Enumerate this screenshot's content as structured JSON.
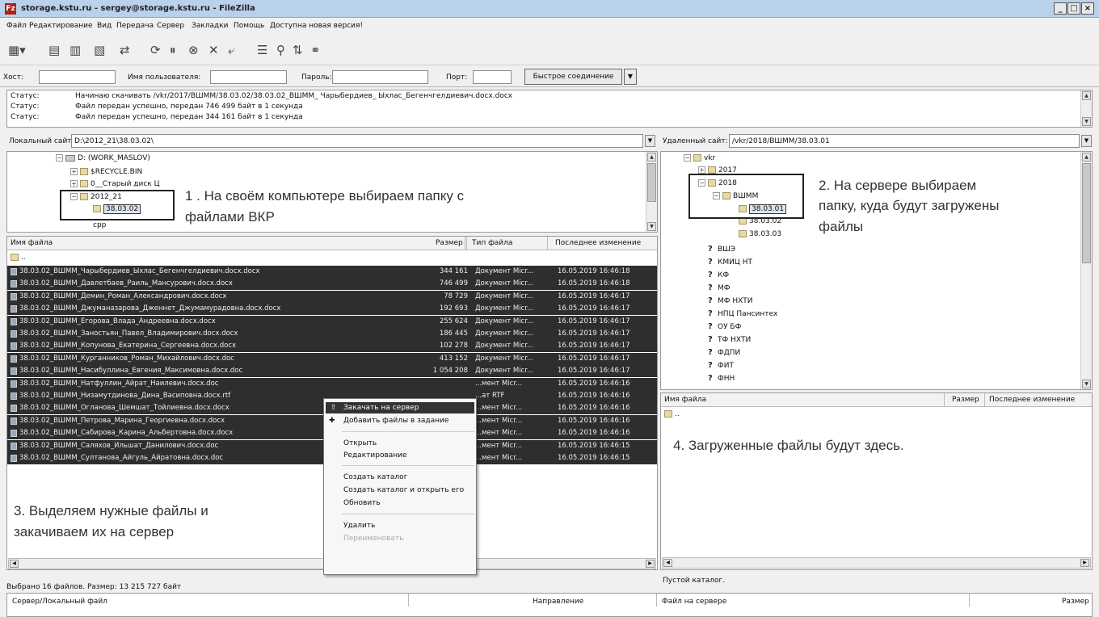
{
  "window": {
    "title": "storage.kstu.ru - sergey@storage.kstu.ru - FileZilla",
    "app_icon_text": "Fz",
    "controls": {
      "minimize": "_",
      "maximize": "□",
      "close": "×"
    }
  },
  "menu": [
    "Файл",
    "Редактирование",
    "Вид",
    "Передача",
    "Сервер",
    "Закладки",
    "Помощь",
    "Доступна новая версия!"
  ],
  "toolbar": {
    "icons": [
      "site-manager-icon",
      "toggle-log-icon",
      "toggle-local-tree-icon",
      "toggle-remote-tree-icon",
      "toggle-queue-icon",
      "refresh-icon",
      "process-queue-icon",
      "cancel-icon",
      "disconnect-icon",
      "reconnect-icon",
      "filter-icon",
      "compare-icon",
      "sync-browse-icon",
      "search-icon"
    ]
  },
  "quickconnect": {
    "host_label": "Хост:",
    "host_value": "",
    "user_label": "Имя пользователя:",
    "user_value": "",
    "pass_label": "Пароль:",
    "pass_value": "",
    "port_label": "Порт:",
    "port_value": "",
    "connect_button": "Быстрое соединение",
    "dropdown_arrow": "▼"
  },
  "log": [
    {
      "key": "Статус:",
      "text": "Начинаю скачивать /vkr/2017/ВШММ/38.03.02/38.03.02_ВШММ_ Чарыбердиев_ Ыхлас_Бегенчгелдиевич.docx.docx"
    },
    {
      "key": "Статус:",
      "text": "Файл передан успешно, передан 746 499 байт в 1 секунда"
    },
    {
      "key": "Статус:",
      "text": "Файл передан успешно, передан 344 161 байт в 1 секунда"
    }
  ],
  "local": {
    "path_label": "Локальный сайт:",
    "path_value": "D:\\2012_21\\38.03.02\\",
    "tree": {
      "drive": "D: (WORK_MASLOV)",
      "recycle": "$RECYCLE.BIN",
      "old_disk": "0__Старый диск Ц",
      "folder": "2012_21",
      "subfolder": "38.03.02",
      "cutoff": "cpp"
    },
    "columns": {
      "name": "Имя файла",
      "size": "Размер",
      "type": "Тип файла",
      "modified": "Последнее изменение"
    },
    "parent": "..",
    "files": [
      {
        "name": "38.03.02_ВШММ_Чарыбердиев_Ыхлас_Бегенчгелдиевич.docx.docx",
        "size": "344 161",
        "type": "Документ Micr...",
        "date": "16.05.2019 16:46:18"
      },
      {
        "name": "38.03.02_ВШММ_Давлетбаев_Раиль_Мансурович.docx.docx",
        "size": "746 499",
        "type": "Документ Micr...",
        "date": "16.05.2019 16:46:18"
      },
      {
        "name": "38.03.02_ВШММ_Демин_Роман_Александрович.docx.docx",
        "size": "78 729",
        "type": "Документ Micr...",
        "date": "16.05.2019 16:46:17"
      },
      {
        "name": "38.03.02_ВШММ_Джуманазарова_Дженнет_Джумамурадовна.docx.docx",
        "size": "192 693",
        "type": "Документ Micr...",
        "date": "16.05.2019 16:46:17"
      },
      {
        "name": "38.03.02_ВШММ_Егорова_Влада_Андреевна.docx.docx",
        "size": "255 624",
        "type": "Документ Micr...",
        "date": "16.05.2019 16:46:17"
      },
      {
        "name": "38.03.02_ВШММ_Заностьян_Павел_Владимирович.docx.docx",
        "size": "186 445",
        "type": "Документ Micr...",
        "date": "16.05.2019 16:46:17"
      },
      {
        "name": "38.03.02_ВШММ_Копунова_Екатерина_Сергеевна.docx.docx",
        "size": "102 278",
        "type": "Документ Micr...",
        "date": "16.05.2019 16:46:17"
      },
      {
        "name": "38.03.02_ВШММ_Курганников_Роман_Михайлович.docx.doc",
        "size": "413 152",
        "type": "Документ Micr...",
        "date": "16.05.2019 16:46:17"
      },
      {
        "name": "38.03.02_ВШММ_Насибуллина_Евгения_Максимовна.docx.doc",
        "size": "1 054 208",
        "type": "Документ Micr...",
        "date": "16.05.2019 16:46:17"
      },
      {
        "name": "38.03.02_ВШММ_Натфуллин_Айрат_Наилевич.docx.doc",
        "size": "",
        "type": "...мент Micr...",
        "date": "16.05.2019 16:46:16"
      },
      {
        "name": "38.03.02_ВШММ_Низамутдинова_Дина_Васиповна.docx.rtf",
        "size": "",
        "type": "...ат RTF",
        "date": "16.05.2019 16:46:16"
      },
      {
        "name": "38.03.02_ВШММ_Огланова_Шемшат_Тойлиевна.docx.docx",
        "size": "",
        "type": "...мент Micr...",
        "date": "16.05.2019 16:46:16"
      },
      {
        "name": "38.03.02_ВШММ_Петрова_Марина_Георгиевна.docx.docx",
        "size": "",
        "type": "...мент Micr...",
        "date": "16.05.2019 16:46:16"
      },
      {
        "name": "38.03.02_ВШММ_Сабирова_Карина_Альбертовна.docx.docx",
        "size": "",
        "type": "...мент Micr...",
        "date": "16.05.2019 16:46:16"
      },
      {
        "name": "38.03.02_ВШММ_Саляхов_Ильшат_Данилович.docx.doc",
        "size": "",
        "type": "...мент Micr...",
        "date": "16.05.2019 16:46:15"
      },
      {
        "name": "38.03.02_ВШММ_Султанова_Айгуль_Айратовна.docx.doc",
        "size": "",
        "type": "...мент Micr...",
        "date": "16.05.2019 16:46:15"
      }
    ],
    "status": "Выбрано 16 файлов. Размер: 13 215 727 байт"
  },
  "remote": {
    "path_label": "Удаленный сайт:",
    "path_value": "/vkr/2018/ВШММ/38.03.01",
    "tree": {
      "root": "vkr",
      "y2017": "2017",
      "y2018": "2018",
      "vshmm": "ВШММ",
      "n1": "38.03.01",
      "n2": "38.03.02",
      "n3": "38.03.03",
      "others": [
        "ВШЭ",
        "КМИЦ НТ",
        "КФ",
        "МФ",
        "МФ НХТИ",
        "НПЦ Пансинтех",
        "ОУ БФ",
        "ТФ НХТИ",
        "ФДПИ",
        "ФИТ",
        "ФНН"
      ]
    },
    "columns": {
      "name": "Имя файла",
      "size": "Размер",
      "modified": "Последнее изменение"
    },
    "parent": "..",
    "status": "Пустой каталог."
  },
  "context_menu": {
    "upload": "Закачать на сервер",
    "add_queue": "Добавить файлы в задание",
    "open": "Открыть",
    "edit": "Редактирование",
    "mkdir": "Создать каталог",
    "mkdir_open": "Создать каталог и открыть его",
    "refresh": "Обновить",
    "delete": "Удалить",
    "rename": "Переименовать"
  },
  "annotations": {
    "a1_line1": "1 . На своём компьютере выбираем папку с",
    "a1_line2": "файлами ВКР",
    "a2_line1": "2. На сервере выбираем",
    "a2_line2": "папку, куда будут загружены",
    "a2_line3": "файлы",
    "a3_line1": "3. Выделяем нужные файлы и",
    "a3_line2": "закачиваем их на сервер",
    "a4": "4. Загруженные файлы будут здесь."
  },
  "queue": {
    "server_local": "Сервер/Локальный файл",
    "direction": "Направление",
    "remote_file": "Файл на сервере",
    "size": "Размер"
  }
}
